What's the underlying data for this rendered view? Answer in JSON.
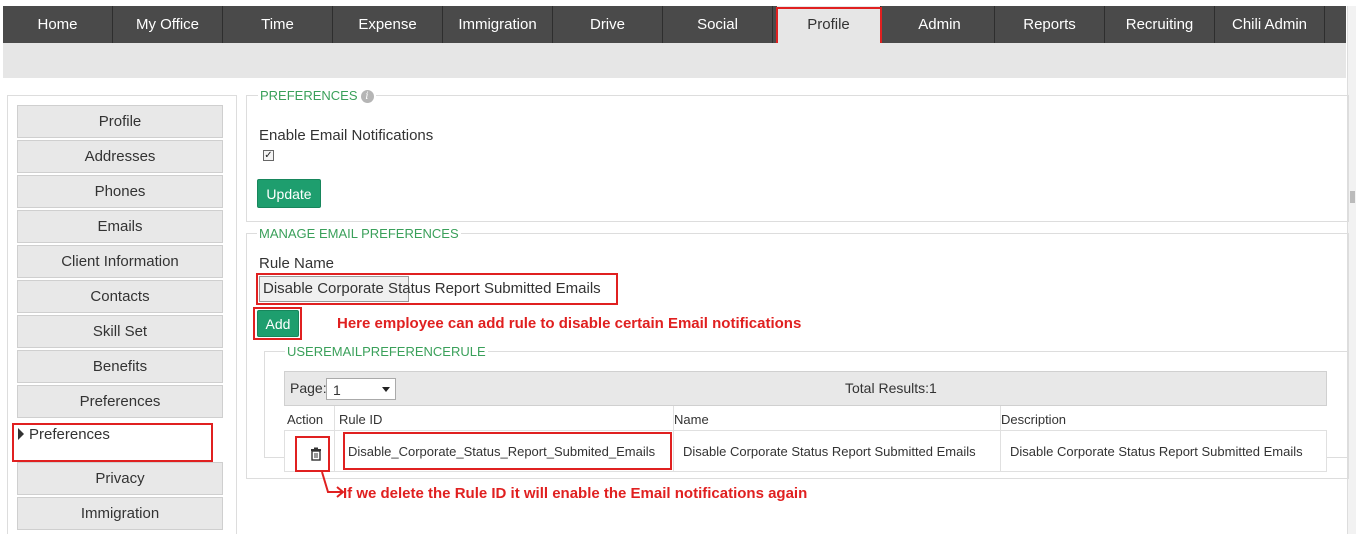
{
  "nav": {
    "tabs": [
      "Home",
      "My Office",
      "Time",
      "Expense",
      "Immigration",
      "Drive",
      "Social",
      "Profile",
      "Admin",
      "Reports",
      "Recruiting",
      "Chili Admin"
    ],
    "active": "Profile"
  },
  "sidebar": {
    "items": [
      "Profile",
      "Addresses",
      "Phones",
      "Emails",
      "Client Information",
      "Contacts",
      "Skill Set",
      "Benefits",
      "Preferences"
    ],
    "active_label": "Preferences",
    "items_after": [
      "Privacy",
      "Immigration"
    ]
  },
  "preferences": {
    "legend": "PREFERENCES",
    "enable_label": "Enable Email Notifications",
    "enabled": true,
    "update_label": "Update"
  },
  "manage": {
    "legend": "MANAGE EMAIL PREFERENCES",
    "rule_name_label": "Rule Name",
    "rule_name_value": "Disable Corporate Status Report Submitted Emails",
    "add_label": "Add"
  },
  "grid": {
    "legend": "USEREMAILPREFERENCERULE",
    "page_label": "Page:",
    "page_value": "1",
    "total": "Total Results:1",
    "columns": [
      "Action",
      "Rule ID",
      "Name",
      "Description"
    ],
    "rows": [
      {
        "rule_id": "Disable_Corporate_Status_Report_Submited_Emails",
        "name": "Disable Corporate Status Report Submitted Emails",
        "description": "Disable Corporate Status Report Submitted Emails"
      }
    ]
  },
  "annotations": {
    "add_note": "Here employee can add rule to disable certain Email notifications",
    "delete_note": "If we delete the Rule ID it will enable the Email notifications again"
  },
  "colors": {
    "nav_bg": "#4a4a4a",
    "accent_green": "#1e9e6e",
    "legend_green": "#3aa05a",
    "annotation_red": "#e02020"
  }
}
